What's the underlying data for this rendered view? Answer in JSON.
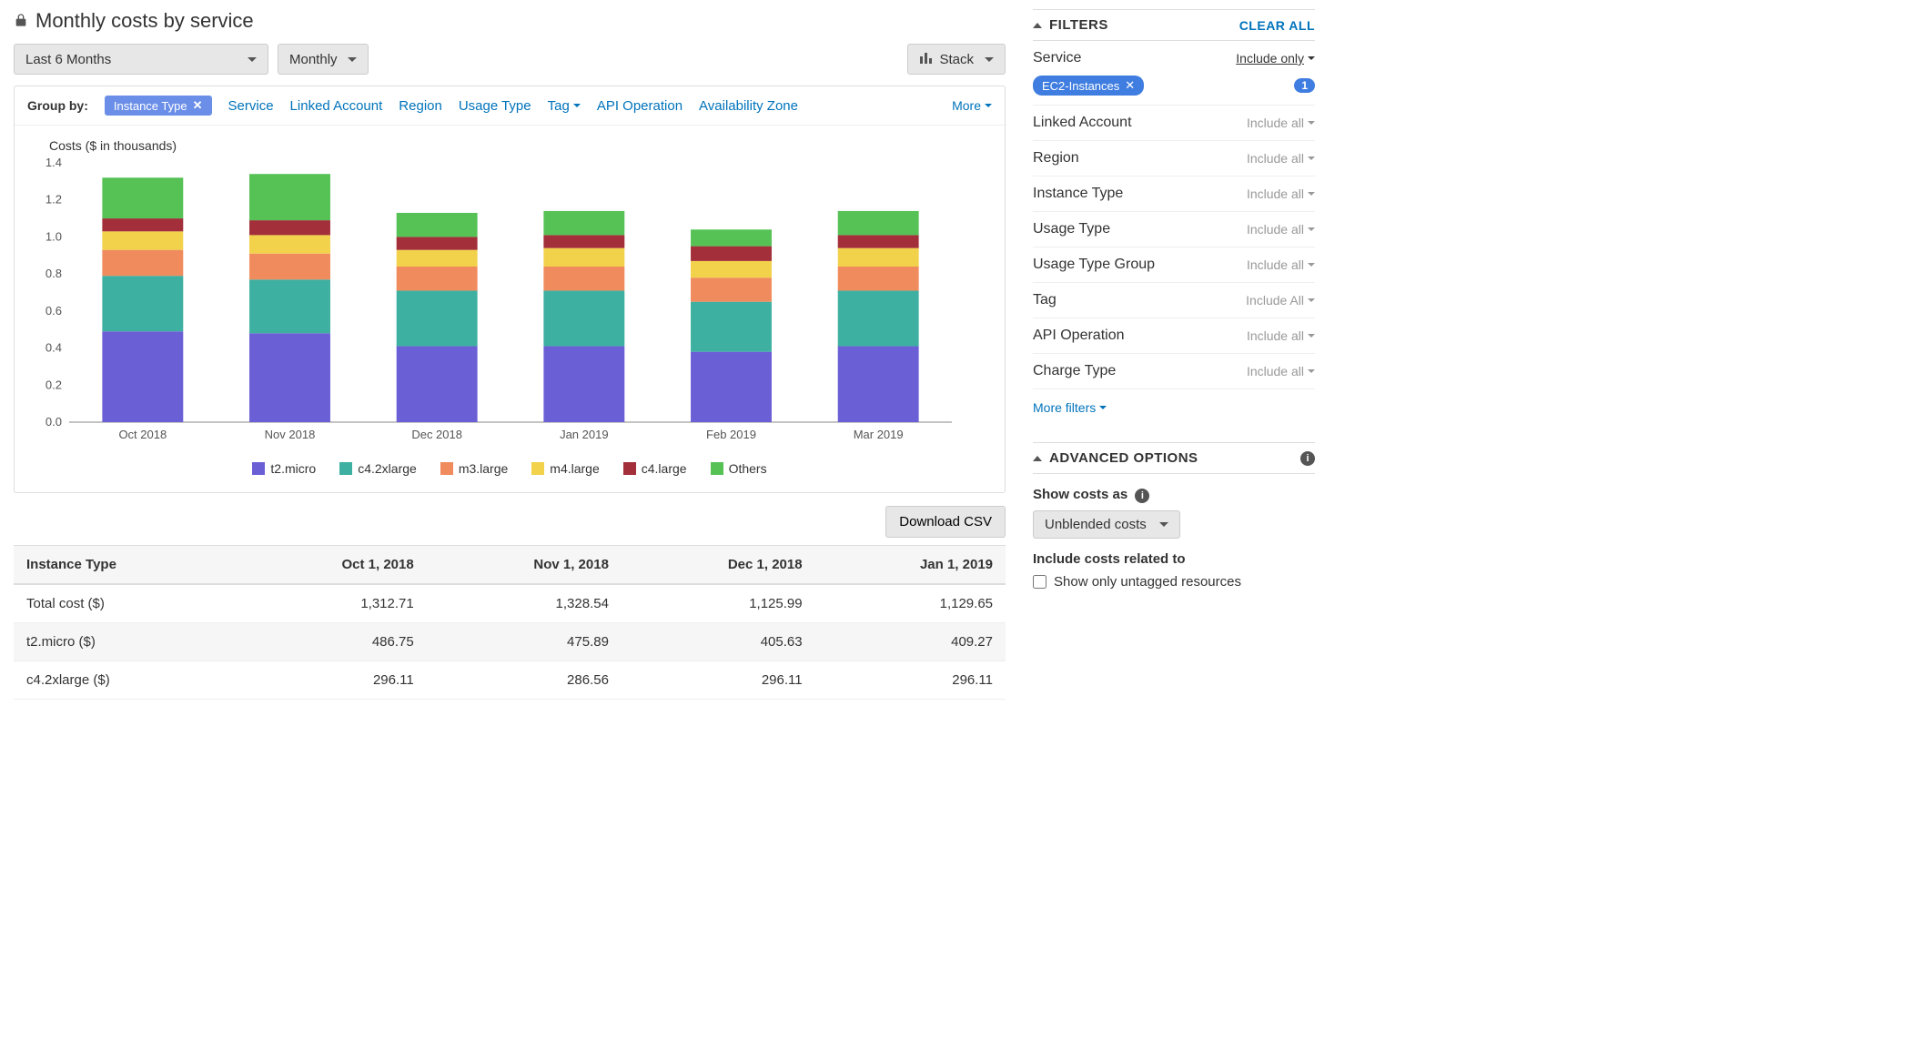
{
  "title": "Monthly costs by service",
  "controls": {
    "range": "Last 6 Months",
    "granularity": "Monthly",
    "stack": "Stack"
  },
  "groupBy": {
    "label": "Group by:",
    "active": "Instance Type",
    "options": [
      "Service",
      "Linked Account",
      "Region",
      "Usage Type",
      "Tag",
      "API Operation",
      "Availability Zone"
    ],
    "more": "More"
  },
  "chart_data": {
    "type": "bar",
    "stacked": true,
    "title": "Costs ($ in thousands)",
    "ylabel": "",
    "ylim": [
      0,
      1.4
    ],
    "yticks": [
      0.0,
      0.2,
      0.4,
      0.6,
      0.8,
      1.0,
      1.2,
      1.4
    ],
    "categories": [
      "Oct 2018",
      "Nov 2018",
      "Dec 2018",
      "Jan 2019",
      "Feb 2019",
      "Mar 2019"
    ],
    "series": [
      {
        "name": "t2.micro",
        "color": "#6b5fd6",
        "values": [
          0.49,
          0.48,
          0.41,
          0.41,
          0.38,
          0.41
        ]
      },
      {
        "name": "c4.2xlarge",
        "color": "#3eb0a1",
        "values": [
          0.3,
          0.29,
          0.3,
          0.3,
          0.27,
          0.3
        ]
      },
      {
        "name": "m3.large",
        "color": "#f08b5d",
        "values": [
          0.14,
          0.14,
          0.13,
          0.13,
          0.13,
          0.13
        ]
      },
      {
        "name": "m4.large",
        "color": "#f2d14b",
        "values": [
          0.1,
          0.1,
          0.09,
          0.1,
          0.09,
          0.1
        ]
      },
      {
        "name": "c4.large",
        "color": "#a22f3a",
        "values": [
          0.07,
          0.08,
          0.07,
          0.07,
          0.08,
          0.07
        ]
      },
      {
        "name": "Others",
        "color": "#56c256",
        "values": [
          0.22,
          0.25,
          0.13,
          0.13,
          0.09,
          0.13
        ]
      }
    ]
  },
  "download": "Download CSV",
  "table": {
    "headers": [
      "Instance Type",
      "Oct 1, 2018",
      "Nov 1, 2018",
      "Dec 1, 2018",
      "Jan 1, 2019"
    ],
    "rows": [
      [
        "Total cost ($)",
        "1,312.71",
        "1,328.54",
        "1,125.99",
        "1,129.65"
      ],
      [
        "t2.micro ($)",
        "486.75",
        "475.89",
        "405.63",
        "409.27"
      ],
      [
        "c4.2xlarge ($)",
        "296.11",
        "286.56",
        "296.11",
        "296.11"
      ]
    ]
  },
  "filters": {
    "title": "FILTERS",
    "clear": "CLEAR ALL",
    "service": {
      "label": "Service",
      "mode": "Include only",
      "chip": "EC2-Instances",
      "count": "1"
    },
    "rows": [
      {
        "label": "Linked Account",
        "value": "Include all"
      },
      {
        "label": "Region",
        "value": "Include all"
      },
      {
        "label": "Instance Type",
        "value": "Include all"
      },
      {
        "label": "Usage Type",
        "value": "Include all"
      },
      {
        "label": "Usage Type Group",
        "value": "Include all"
      },
      {
        "label": "Tag",
        "value": "Include All"
      },
      {
        "label": "API Operation",
        "value": "Include all"
      },
      {
        "label": "Charge Type",
        "value": "Include all"
      }
    ],
    "more": "More filters"
  },
  "advanced": {
    "title": "ADVANCED OPTIONS",
    "showCostsAs": "Show costs as",
    "costType": "Unblended costs",
    "includeRelated": "Include costs related to",
    "untagged": "Show only untagged resources"
  }
}
